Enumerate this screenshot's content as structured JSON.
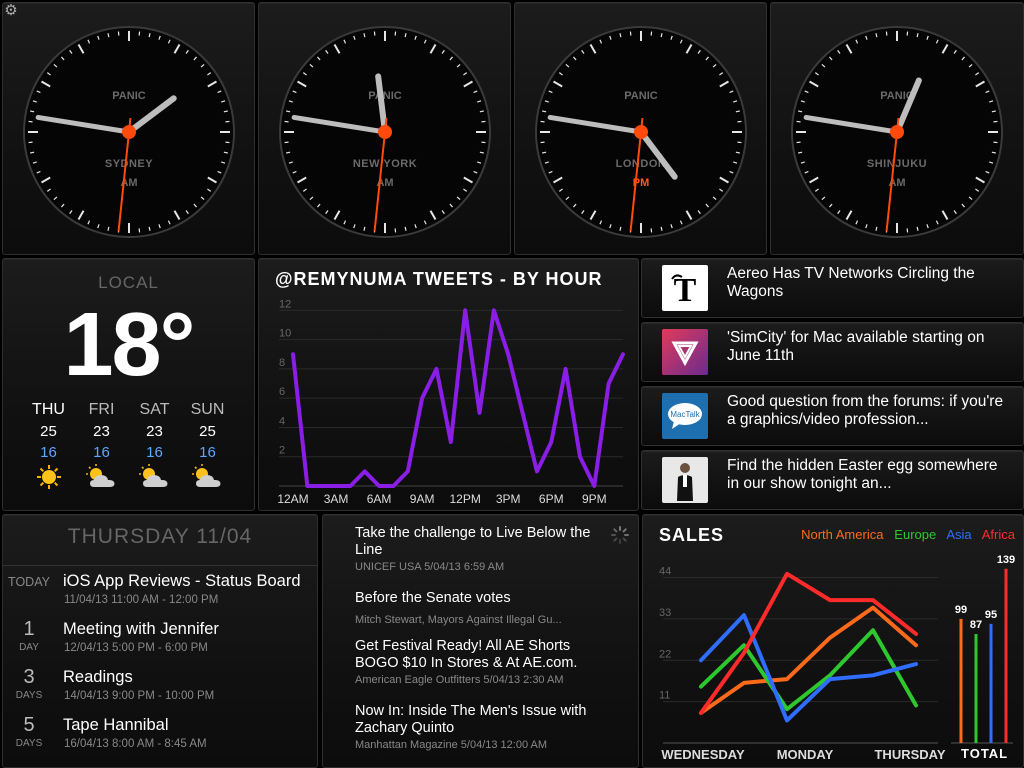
{
  "clocks": [
    {
      "company": "PANIC",
      "city": "SYDNEY",
      "ampm": "AM",
      "hour": 1,
      "minute": 46,
      "second": 31
    },
    {
      "company": "PANIC",
      "city": "NEW YORK",
      "ampm": "AM",
      "hour": 11,
      "minute": 46,
      "second": 31
    },
    {
      "company": "PANIC",
      "city": "LONDON",
      "ampm": "PM",
      "hour": 4,
      "minute": 46,
      "second": 31
    },
    {
      "company": "PANIC",
      "city": "SHINJUKU",
      "ampm": "AM",
      "hour": 12,
      "minute": 46,
      "second": 31
    }
  ],
  "weather": {
    "label": "LOCAL",
    "temp": "18°",
    "days": [
      {
        "name": "THU",
        "hi": "25",
        "lo": "16",
        "icon": "sun-icon"
      },
      {
        "name": "FRI",
        "hi": "23",
        "lo": "16",
        "icon": "partly-cloudy-icon"
      },
      {
        "name": "SAT",
        "hi": "23",
        "lo": "16",
        "icon": "partly-cloudy-icon"
      },
      {
        "name": "SUN",
        "hi": "25",
        "lo": "16",
        "icon": "partly-cloudy-icon"
      }
    ]
  },
  "tweets_chart": {
    "title": "@REMYNUMA TWEETS - BY HOUR"
  },
  "headlines": [
    {
      "text": "Aereo Has TV Networks Circling the Wagons",
      "icon": "nyt-logo-icon"
    },
    {
      "text": "'SimCity' for Mac available starting on June 11th",
      "icon": "verge-logo-icon"
    },
    {
      "text": "Good question from the forums: if you're a graphics/video profession...",
      "icon": "mactalk-logo-icon"
    },
    {
      "text": "Find the hidden Easter egg somewhere in our show tonight an...",
      "icon": "person-photo-icon"
    }
  ],
  "calendar": {
    "title": "THURSDAY 11/04",
    "events": [
      {
        "label": "TODAY",
        "num": "",
        "unit": "",
        "title": "iOS App Reviews - Status Board",
        "time": "11/04/13 11:00 AM - 12:00 PM"
      },
      {
        "label": "",
        "num": "1",
        "unit": "DAY",
        "title": "Meeting with Jennifer",
        "time": "12/04/13 5:00 PM - 6:00 PM"
      },
      {
        "label": "",
        "num": "3",
        "unit": "DAYS",
        "title": "Readings",
        "time": "14/04/13 9:00 PM - 10:00 PM"
      },
      {
        "label": "",
        "num": "5",
        "unit": "DAYS",
        "title": "Tape Hannibal",
        "time": "16/04/13 8:00 AM - 8:45 AM"
      }
    ]
  },
  "feed": [
    {
      "title": "Take the challenge to Live Below the Line",
      "meta": "UNICEF USA 5/04/13 6:59 AM"
    },
    {
      "title": "Before the Senate votes",
      "meta": "Mitch Stewart, Mayors Against Illegal Gu..."
    },
    {
      "title": "Get Festival Ready! All AE Shorts BOGO $10 In Stores & At AE.com.",
      "meta": "American Eagle Outfitters 5/04/13 2:30 AM"
    },
    {
      "title": "Now In: Inside The Men's Issue with Zachary Quinto",
      "meta": "Manhattan Magazine 5/04/13 12:00 AM"
    }
  ],
  "sales": {
    "title": "SALES",
    "total_label": "TOTAL",
    "legend": [
      {
        "name": "North America",
        "color": "#ff6a1a"
      },
      {
        "name": "Europe",
        "color": "#2ec82e"
      },
      {
        "name": "Asia",
        "color": "#2f6dff"
      },
      {
        "name": "Africa",
        "color": "#ff2a2a"
      }
    ]
  },
  "chart_data": [
    {
      "type": "line",
      "title": "@REMYNUMA TWEETS - BY HOUR",
      "x": [
        0,
        1,
        2,
        3,
        4,
        5,
        6,
        7,
        8,
        9,
        10,
        11,
        12,
        13,
        14,
        15,
        16,
        17,
        18,
        19,
        20,
        21,
        22,
        23
      ],
      "xticks": [
        "12AM",
        "3AM",
        "6AM",
        "9AM",
        "12PM",
        "3PM",
        "6PM",
        "9PM"
      ],
      "yticks": [
        "2",
        "4",
        "6",
        "8",
        "10",
        "12"
      ],
      "ylim": [
        0,
        12.5
      ],
      "series": [
        {
          "values": [
            9,
            0,
            0,
            0,
            0,
            1,
            0,
            0,
            1,
            6,
            8,
            3,
            12,
            5,
            12,
            9,
            5,
            1,
            3,
            8,
            2,
            0,
            7,
            9
          ],
          "color": "#8a1ee6"
        }
      ],
      "grid": true
    },
    {
      "type": "line",
      "title": "SALES",
      "categories": [
        "WEDNESDAY",
        "MONDAY",
        "THURSDAY"
      ],
      "x": [
        0,
        1,
        2,
        3,
        4,
        5
      ],
      "yticks": [
        "11",
        "22",
        "33",
        "44"
      ],
      "ylim": [
        0,
        50
      ],
      "series": [
        {
          "name": "North America",
          "color": "#ff6a1a",
          "values": [
            8,
            16,
            17,
            28,
            36,
            26
          ]
        },
        {
          "name": "Europe",
          "color": "#2ec82e",
          "values": [
            15,
            26,
            9,
            18,
            30,
            10
          ]
        },
        {
          "name": "Asia",
          "color": "#2f6dff",
          "values": [
            22,
            34,
            6,
            17,
            18,
            21
          ]
        },
        {
          "name": "Africa",
          "color": "#ff2a2a",
          "values": [
            8,
            24,
            45,
            38,
            38,
            29
          ]
        }
      ],
      "totals": [
        {
          "name": "North America",
          "value": 99,
          "color": "#ff6a1a"
        },
        {
          "name": "Europe",
          "value": 87,
          "color": "#2ec82e"
        },
        {
          "name": "Asia",
          "value": 95,
          "color": "#2f6dff"
        },
        {
          "name": "Africa",
          "value": 139,
          "color": "#ff2a2a"
        }
      ],
      "grid": true
    }
  ]
}
